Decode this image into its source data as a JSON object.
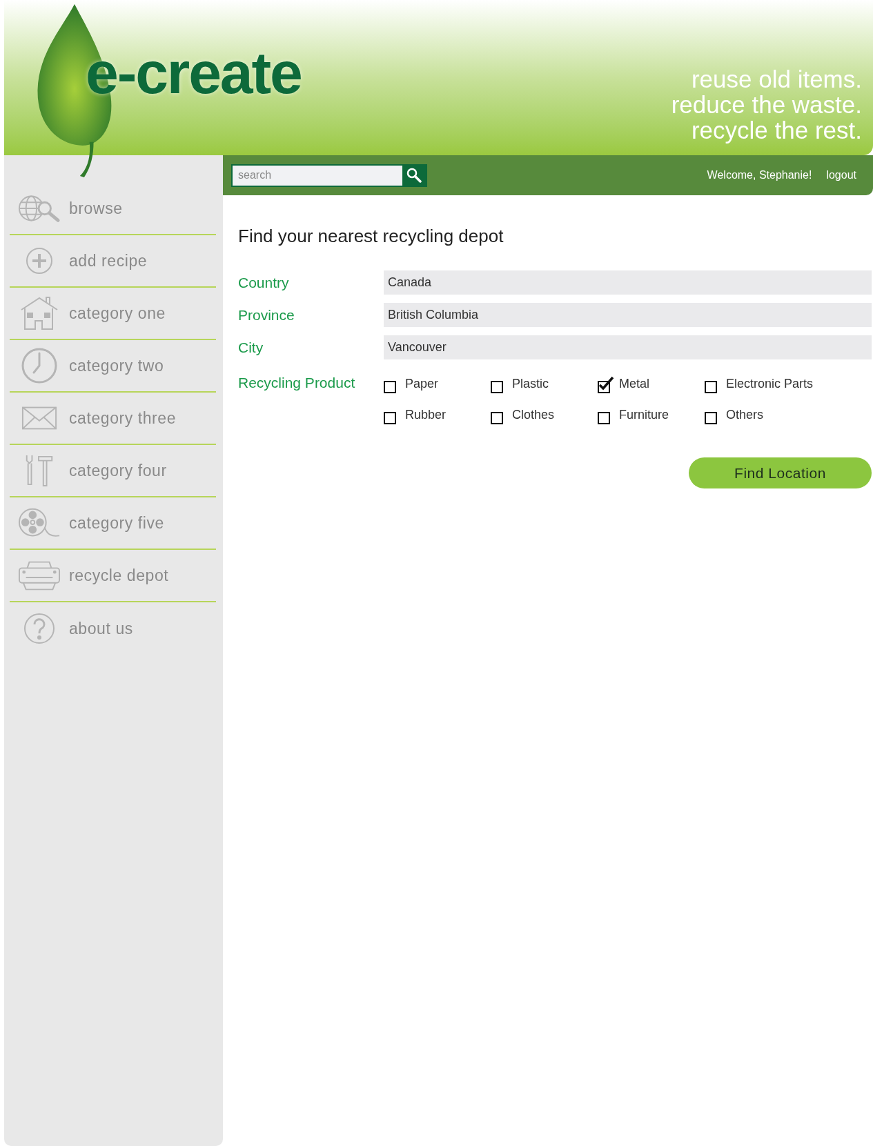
{
  "header": {
    "logo": "e-create",
    "tagline": [
      "reuse old items.",
      "reduce the waste.",
      "recycle the rest."
    ]
  },
  "navbar": {
    "search": {
      "placeholder": "search"
    },
    "welcome": "Welcome, Stephanie!",
    "logout": "logout"
  },
  "sidebar": {
    "items": [
      {
        "label": "browse"
      },
      {
        "label": "add recipe"
      },
      {
        "label": "category one"
      },
      {
        "label": "category two"
      },
      {
        "label": "category three"
      },
      {
        "label": "category four"
      },
      {
        "label": "category five"
      },
      {
        "label": "recycle depot"
      },
      {
        "label": "about us"
      }
    ]
  },
  "form": {
    "title": "Find your nearest recycling depot",
    "fields": [
      {
        "label": "Country",
        "value": "Canada"
      },
      {
        "label": "Province",
        "value": "British Columbia"
      },
      {
        "label": "City",
        "value": "Vancouver"
      }
    ],
    "products_label": "Recycling Product",
    "products": [
      {
        "label": "Paper",
        "checked": false
      },
      {
        "label": "Plastic",
        "checked": false
      },
      {
        "label": "Metal",
        "checked": true
      },
      {
        "label": "Electronic Parts",
        "checked": false
      },
      {
        "label": "Rubber",
        "checked": false
      },
      {
        "label": "Clothes",
        "checked": false
      },
      {
        "label": "Furniture",
        "checked": false
      },
      {
        "label": "Others",
        "checked": false
      }
    ],
    "submit": "Find Location"
  }
}
